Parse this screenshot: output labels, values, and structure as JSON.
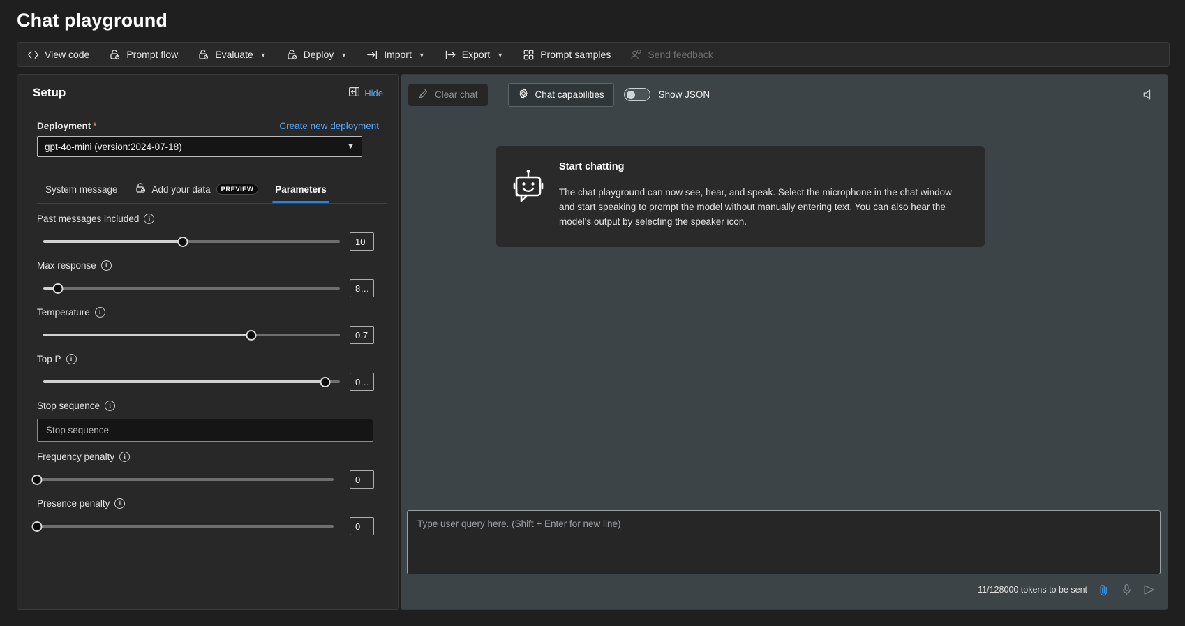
{
  "header": {
    "title": "Chat playground"
  },
  "commandbar": {
    "items": [
      {
        "label": "View code",
        "icon": "code-icon",
        "caret": false,
        "disabled": false
      },
      {
        "label": "Prompt flow",
        "icon": "prompt-flow-icon",
        "caret": false,
        "disabled": false
      },
      {
        "label": "Evaluate",
        "icon": "evaluate-icon",
        "caret": true,
        "disabled": false
      },
      {
        "label": "Deploy",
        "icon": "deploy-icon",
        "caret": true,
        "disabled": false
      },
      {
        "label": "Import",
        "icon": "import-icon",
        "caret": true,
        "disabled": false
      },
      {
        "label": "Export",
        "icon": "export-icon",
        "caret": true,
        "disabled": false
      },
      {
        "label": "Prompt samples",
        "icon": "grid-icon",
        "caret": false,
        "disabled": false
      },
      {
        "label": "Send feedback",
        "icon": "feedback-icon",
        "caret": false,
        "disabled": true
      }
    ]
  },
  "setup": {
    "title": "Setup",
    "hide_label": "Hide",
    "hide_icon": "panel-collapse-icon",
    "deployment": {
      "label": "Deployment",
      "required_marker": "*",
      "create_link": "Create new deployment",
      "selected": "gpt-4o-mini (version:2024-07-18)",
      "chevron": "chevron-down-icon"
    },
    "tabs": [
      {
        "label": "System message",
        "active": false,
        "badge": null,
        "icon": null
      },
      {
        "label": "Add your data",
        "active": false,
        "badge": "PREVIEW",
        "icon": "add-data-icon"
      },
      {
        "label": "Parameters",
        "active": true,
        "badge": null,
        "icon": null
      }
    ],
    "parameters": [
      {
        "label": "Past messages included",
        "value": "10",
        "fill_pct": 47,
        "type": "slider"
      },
      {
        "label": "Max response",
        "value": "8…",
        "fill_pct": 5,
        "type": "slider"
      },
      {
        "label": "Temperature",
        "value": "0.7",
        "fill_pct": 70,
        "type": "slider"
      },
      {
        "label": "Top P",
        "value": "0…",
        "fill_pct": 95,
        "type": "slider"
      },
      {
        "label": "Stop sequence",
        "placeholder": "Stop sequence",
        "type": "text"
      },
      {
        "label": "Frequency penalty",
        "value": "0",
        "fill_pct": 0,
        "type": "slider"
      },
      {
        "label": "Presence penalty",
        "value": "0",
        "fill_pct": 0,
        "type": "slider"
      }
    ]
  },
  "chat": {
    "clear_chat": {
      "label": "Clear chat",
      "icon": "broom-icon",
      "disabled": true
    },
    "capabilities": {
      "label": "Chat capabilities",
      "icon": "gear-icon"
    },
    "show_json": {
      "label": "Show JSON",
      "on": false
    },
    "speaker_icon": "speaker-icon",
    "card": {
      "icon": "robot-icon",
      "title": "Start chatting",
      "body": "The chat playground can now see, hear, and speak. Select the microphone in the chat window and start speaking to prompt the model without manually entering text. You can also hear the model's output by selecting the speaker icon."
    },
    "composer": {
      "placeholder": "Type user query here. (Shift + Enter for new line)"
    },
    "footer": {
      "tokens": "11/128000 tokens to be sent",
      "attach_icon": "paperclip-icon",
      "mic_icon": "microphone-icon",
      "send_icon": "send-icon"
    }
  },
  "colors": {
    "accent": "#1f86e8",
    "link": "#5aa9f8",
    "required": "#e9707a",
    "chat_bg": "#3c4448",
    "panel_bg": "#282828"
  }
}
